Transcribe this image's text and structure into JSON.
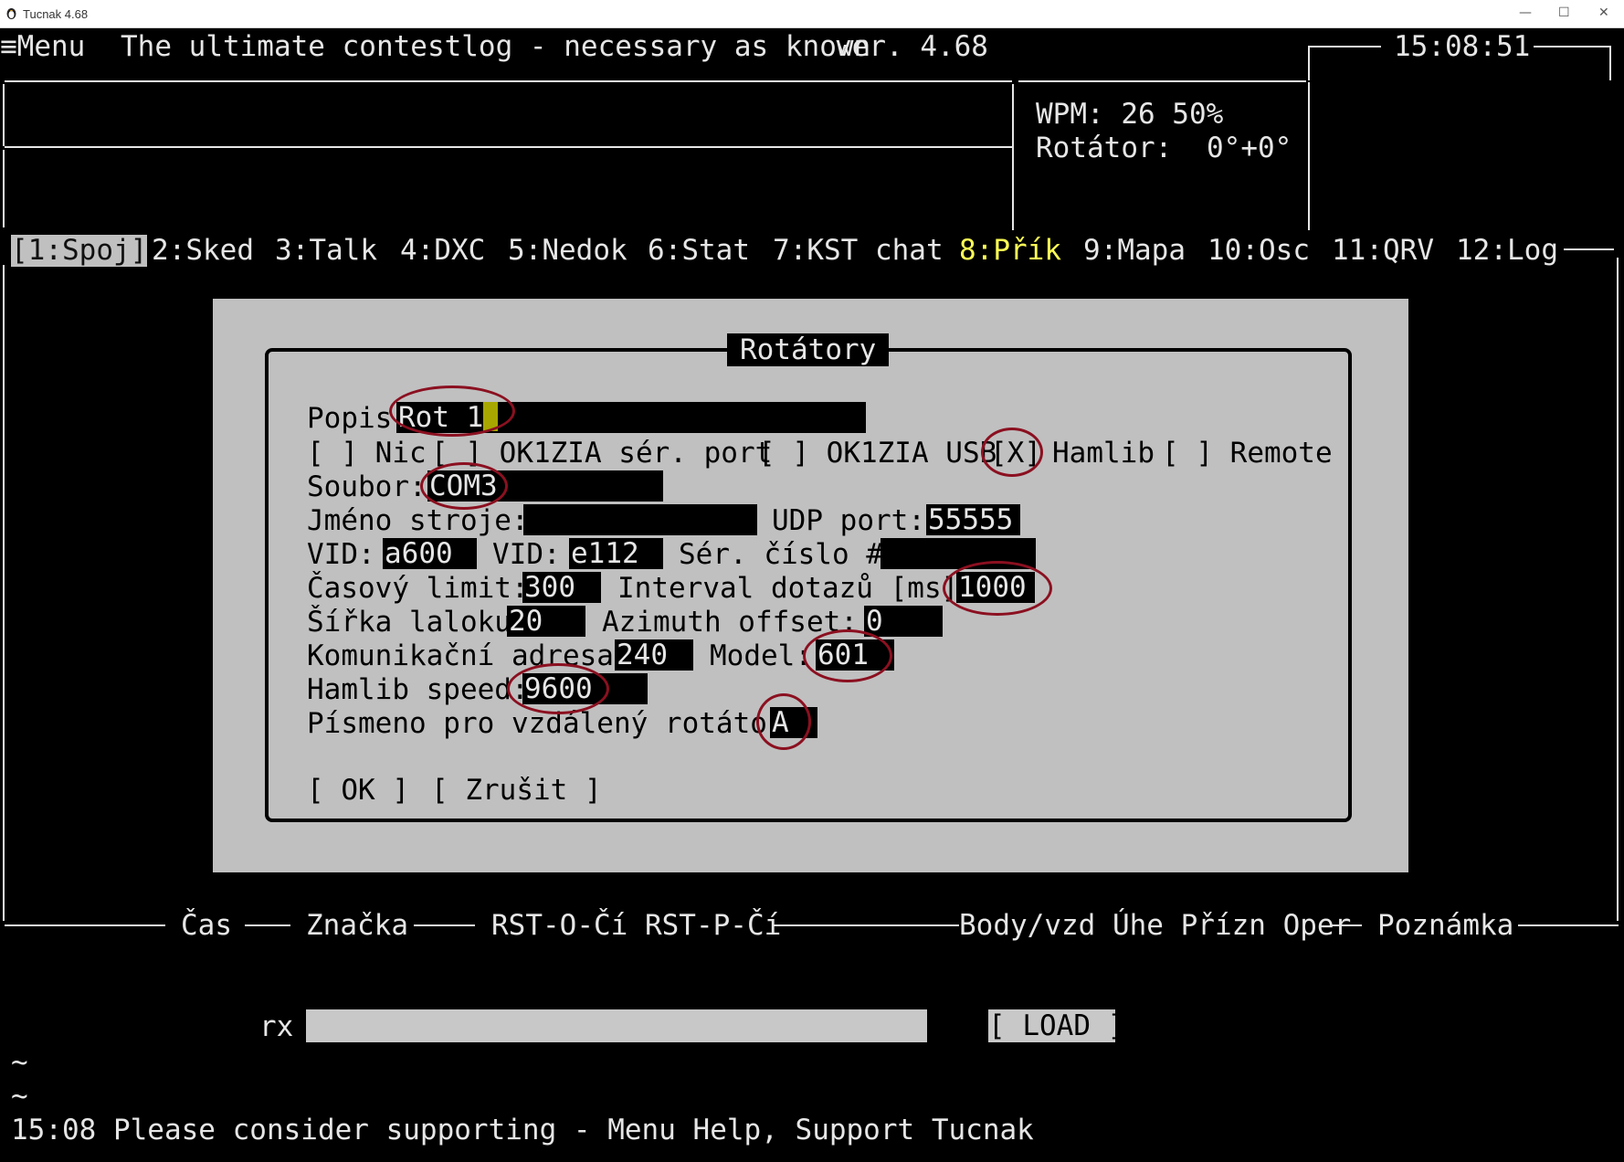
{
  "window": {
    "title": "Tucnak 4.68"
  },
  "header": {
    "menu_label": "≡Menu",
    "tagline": "The ultimate contestlog - necessary as known",
    "version": "ver. 4.68",
    "clock": "15:08:51"
  },
  "status": {
    "wpm": "WPM: 26 50%",
    "rotator_label": "Rotátor:",
    "rotator_value": "0°+0°"
  },
  "tabs": [
    {
      "label": "[1:Spoj]"
    },
    {
      "label": "2:Sked"
    },
    {
      "label": "3:Talk"
    },
    {
      "label": "4:DXC"
    },
    {
      "label": "5:Nedok"
    },
    {
      "label": "6:Stat"
    },
    {
      "label": "7:KST chat"
    },
    {
      "label": "8:Přík"
    },
    {
      "label": "9:Mapa"
    },
    {
      "label": "10:Osc"
    },
    {
      "label": "11:QRV"
    },
    {
      "label": "12:Log"
    }
  ],
  "dialog": {
    "title": "Rotátory",
    "popis_label": "Popis",
    "popis_value": "Rot 1",
    "type_nic": "[ ] Nic",
    "type_ser": "[ ] OK1ZIA sér. port",
    "type_usb": "[ ] OK1ZIA USB",
    "type_hamlib_box": "[X]",
    "type_hamlib": "Hamlib",
    "type_remote": "[ ] Remote",
    "soubor_label": "Soubor:",
    "soubor_value": "COM3",
    "jmeno_label": "Jméno stroje:",
    "jmeno_value": "",
    "udp_label": "UDP port:",
    "udp_value": "55555",
    "vid_label": "VID:",
    "vid_value": "a600",
    "vid2_label": "VID:",
    "vid2_value": "e112",
    "ser_label": "Sér. číslo #",
    "ser_value": "",
    "timeout_label": "Časový limit:",
    "timeout_value": "300",
    "interval_label": "Interval dotazů [ms]:",
    "interval_value": "1000",
    "beam_label": "Šířka laloku",
    "beam_value": "20",
    "azoff_label": "Azimuth offset:",
    "azoff_value": "0",
    "komadr_label": "Komunikační adresa:",
    "komadr_value": "240",
    "model_label": "Model:",
    "model_value": "601",
    "hspeed_label": "Hamlib speed:",
    "hspeed_value": "9600",
    "letter_label": "Písmeno pro vzdálený rotátor:",
    "letter_value": "A",
    "ok_button": "[ OK ]",
    "cancel_button": "[ Zrušit ]"
  },
  "log_columns": [
    "Čas",
    "Značka",
    "RST-O-Čí RST-P-Čí",
    "Body/vzd Úhe Přízn Oper",
    "Poznámka"
  ],
  "input": {
    "rx_label": "rx",
    "rx_value": "",
    "load_button": "[ LOAD ]"
  },
  "console": {
    "tilde1": "~",
    "tilde2": "~",
    "message": "15:08 Please consider supporting - Menu Help, Support Tucnak"
  },
  "colors": {
    "highlight_tab": "#ffff55",
    "annotation": "#8b1020",
    "dialog_bg": "#c0c0c0"
  }
}
